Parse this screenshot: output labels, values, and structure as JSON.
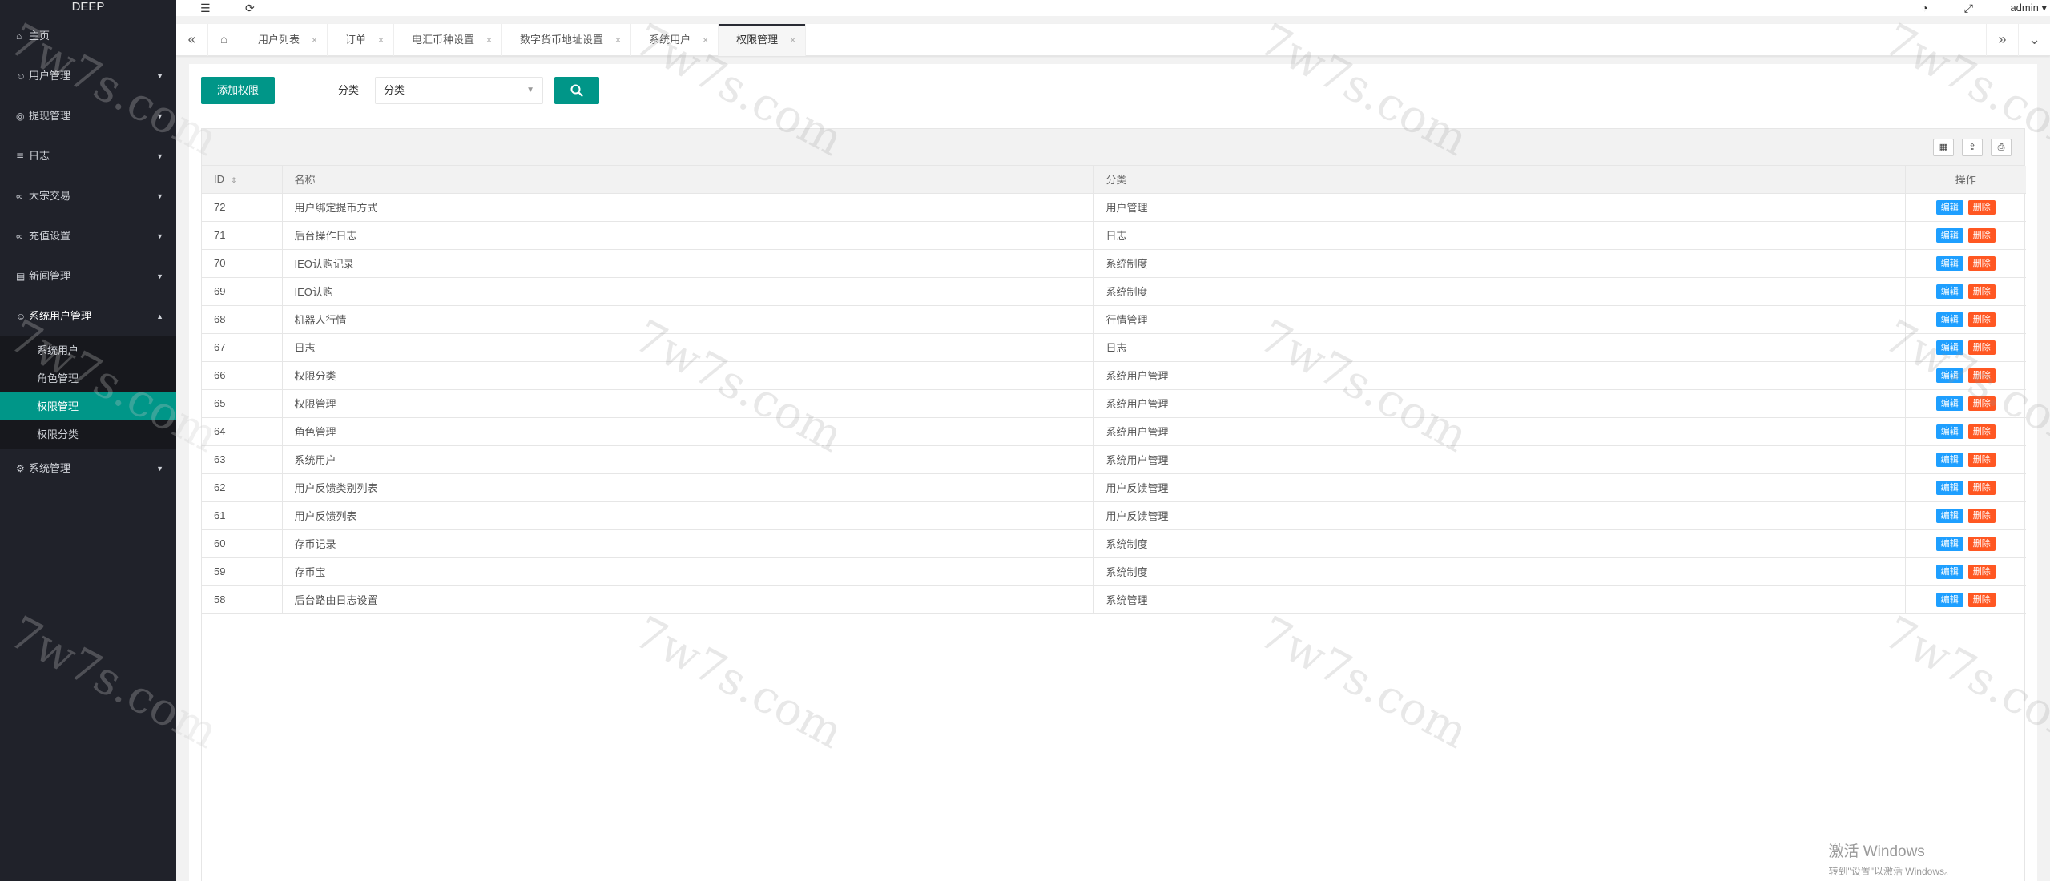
{
  "app": {
    "logo": "DEEP"
  },
  "sidebar": {
    "items": [
      {
        "label": "主页",
        "icon": "home-icon",
        "glyph": "⌂"
      },
      {
        "label": "用户管理",
        "icon": "user-icon",
        "glyph": "☺",
        "arrow": "▼"
      },
      {
        "label": "提现管理",
        "icon": "withdraw-icon",
        "glyph": "◎",
        "arrow": "▼"
      },
      {
        "label": "日志",
        "icon": "log-icon",
        "glyph": "≣",
        "arrow": "▼"
      },
      {
        "label": "大宗交易",
        "icon": "trade-icon",
        "glyph": "∞",
        "arrow": "▼"
      },
      {
        "label": "充值设置",
        "icon": "recharge-icon",
        "glyph": "∞",
        "arrow": "▼"
      },
      {
        "label": "新闻管理",
        "icon": "news-icon",
        "glyph": "▤",
        "arrow": "▼"
      },
      {
        "label": "系统用户管理",
        "icon": "user-group-icon",
        "glyph": "☺",
        "arrow": "▲"
      },
      {
        "label": "系统管理",
        "icon": "settings-icon",
        "glyph": "⚙",
        "arrow": "▼"
      }
    ],
    "submenu": [
      {
        "label": "系统用户"
      },
      {
        "label": "角色管理"
      },
      {
        "label": "权限管理"
      },
      {
        "label": "权限分类"
      }
    ]
  },
  "header": {
    "menu_icon": "☰",
    "refresh_icon": "⟳",
    "theme_icon": "◔",
    "fullscreen_icon": "⤢",
    "admin_label": "admin ▾"
  },
  "tabs": {
    "left_ctrl": "«",
    "home_glyph": "⌂",
    "right_ctrl": "»",
    "down_ctrl": "⌄",
    "close_glyph": "×",
    "items": [
      {
        "label": "用户列表"
      },
      {
        "label": "订单"
      },
      {
        "label": "电汇币种设置"
      },
      {
        "label": "数字货币地址设置"
      },
      {
        "label": "系统用户"
      },
      {
        "label": "权限管理"
      }
    ]
  },
  "filter": {
    "add_button": "添加权限",
    "category_label": "分类",
    "category_value": "分类",
    "caret": "▼"
  },
  "table": {
    "tools": [
      "▦",
      "⇪",
      "⎙"
    ],
    "columns": {
      "id": "ID",
      "name": "名称",
      "category": "分类",
      "ops": "操作"
    },
    "sort_glyph": "⇕",
    "edit_label": "编辑",
    "delete_label": "删除",
    "rows": [
      {
        "id": "72",
        "name": "用户绑定提币方式",
        "category": "用户管理"
      },
      {
        "id": "71",
        "name": "后台操作日志",
        "category": "日志"
      },
      {
        "id": "70",
        "name": "IEO认购记录",
        "category": "系统制度"
      },
      {
        "id": "69",
        "name": "IEO认购",
        "category": "系统制度"
      },
      {
        "id": "68",
        "name": "机器人行情",
        "category": "行情管理"
      },
      {
        "id": "67",
        "name": "日志",
        "category": "日志"
      },
      {
        "id": "66",
        "name": "权限分类",
        "category": "系统用户管理"
      },
      {
        "id": "65",
        "name": "权限管理",
        "category": "系统用户管理"
      },
      {
        "id": "64",
        "name": "角色管理",
        "category": "系统用户管理"
      },
      {
        "id": "63",
        "name": "系统用户",
        "category": "系统用户管理"
      },
      {
        "id": "62",
        "name": "用户反馈类别列表",
        "category": "用户反馈管理"
      },
      {
        "id": "61",
        "name": "用户反馈列表",
        "category": "用户反馈管理"
      },
      {
        "id": "60",
        "name": "存币记录",
        "category": "系统制度"
      },
      {
        "id": "59",
        "name": "存币宝",
        "category": "系统制度"
      },
      {
        "id": "58",
        "name": "后台路由日志设置",
        "category": "系统管理"
      }
    ]
  },
  "watermark": {
    "text": "7w7s.com"
  },
  "activation": {
    "line1": "激活 Windows",
    "line2": "转到\"设置\"以激活 Windows。"
  },
  "colors": {
    "accent": "#009688",
    "sidebar_bg": "#20222a",
    "edit": "#1e9fff",
    "delete": "#ff5722"
  }
}
